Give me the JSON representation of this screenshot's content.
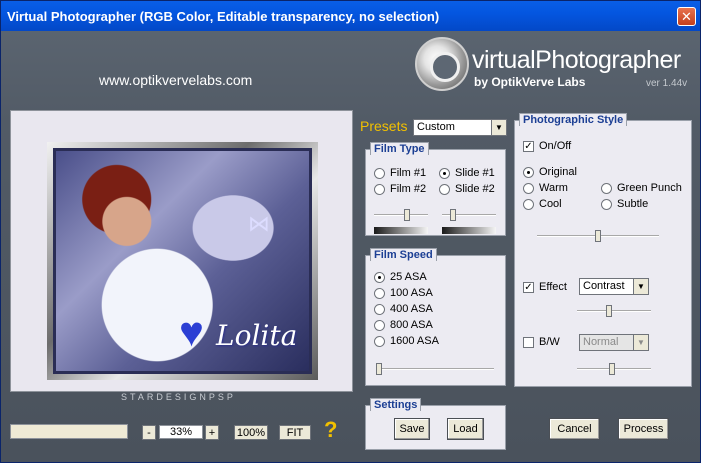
{
  "window": {
    "title": "Virtual Photographer (RGB Color, Editable transparency, no selection)",
    "close_label": "✕"
  },
  "brand": {
    "url": "www.optikvervelabs.com",
    "logo_text": "virtualPhotographer",
    "logo_sub": "by OptikVerve Labs",
    "version": "ver 1.44v"
  },
  "preview": {
    "watermark": "STARDESIGNPSP",
    "signature": "Lolita",
    "heart": "♥",
    "bow": "⋈"
  },
  "zoom": {
    "minus_label": "-",
    "value": "33%",
    "plus_label": "+",
    "hundred_label": "100%",
    "fit_label": "FIT",
    "help_label": "?"
  },
  "presets": {
    "label": "Presets",
    "selected": "Custom"
  },
  "film_type": {
    "title": "Film Type",
    "options": [
      "Film #1",
      "Slide #1",
      "Film #2",
      "Slide #2"
    ],
    "selected": "Slide #1",
    "slider1_level": 0.6,
    "slider2_level": 0.2
  },
  "film_speed": {
    "title": "Film Speed",
    "options": [
      "25 ASA",
      "100 ASA",
      "400 ASA",
      "800 ASA",
      "1600 ASA"
    ],
    "selected": "25 ASA",
    "slider_level": 0.0
  },
  "settings": {
    "title": "Settings",
    "save_label": "Save",
    "load_label": "Load"
  },
  "photographic_style": {
    "title": "Photographic Style",
    "onoff_label": "On/Off",
    "onoff_checked": true,
    "styles": [
      "Original",
      "Warm",
      "Green Punch",
      "Cool",
      "Subtle"
    ],
    "selected_style": "Original",
    "style_slider_level": 0.5,
    "effect_label": "Effect",
    "effect_checked": true,
    "effect_selected": "Contrast",
    "effect_slider_level": 0.4,
    "bw_label": "B/W",
    "bw_checked": false,
    "bw_selected": "Normal",
    "bw_slider_level": 0.5
  },
  "actions": {
    "cancel_label": "Cancel",
    "process_label": "Process"
  },
  "colors": {
    "accent_gold": "#f2c000",
    "title_blue": "#1c3f94"
  }
}
